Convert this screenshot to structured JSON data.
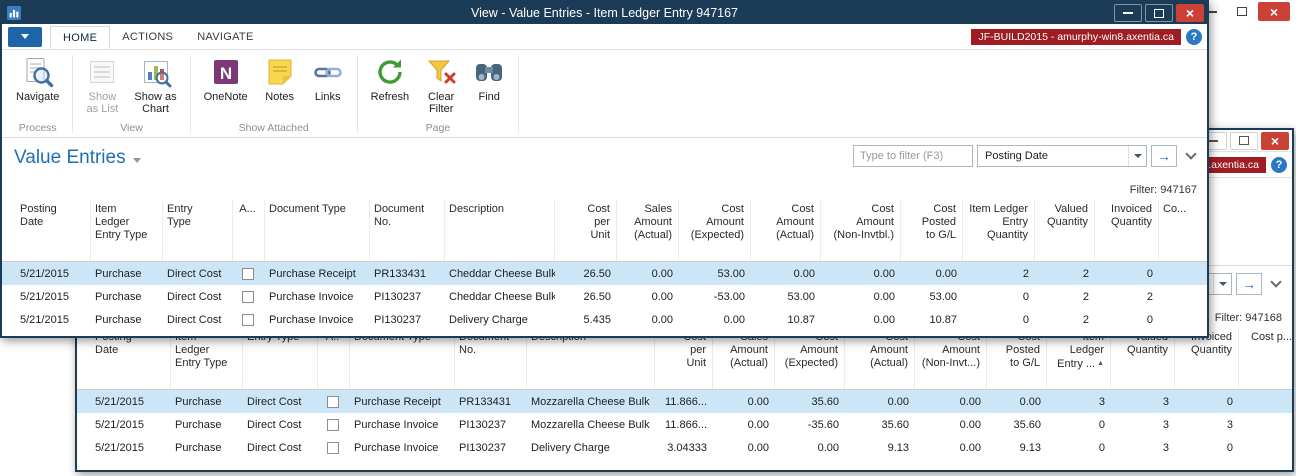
{
  "colors": {
    "titlebar_active": "#1c3b56",
    "window_border": "#1c3b56",
    "close_button_red": "#ca4237",
    "server_badge_red": "#9e1c22",
    "accent_blue": "#1e64a9",
    "help_blue": "#2b79c2",
    "page_title_blue": "#1e6fb8",
    "selected_row_blue": "#cde6f7"
  },
  "windows": [
    {
      "title": "View - Value Entries - Item Ledger Entry 947167",
      "ribbon": {
        "tabs": [
          "HOME",
          "ACTIONS",
          "NAVIGATE"
        ],
        "active_tab": "HOME",
        "server_badge": "JF-BUILD2015 - amurphy-win8.axentia.ca",
        "groups": [
          {
            "label": "Process",
            "buttons": [
              {
                "label": "Navigate",
                "icon": "navigate-icon"
              }
            ]
          },
          {
            "label": "View",
            "buttons": [
              {
                "label": "Show\nas List",
                "icon": "show-as-list-icon",
                "disabled": true
              },
              {
                "label": "Show as\nChart",
                "icon": "show-as-chart-icon"
              }
            ]
          },
          {
            "label": "Show Attached",
            "buttons": [
              {
                "label": "OneNote",
                "icon": "onenote-icon"
              },
              {
                "label": "Notes",
                "icon": "notes-icon"
              },
              {
                "label": "Links",
                "icon": "links-icon"
              }
            ]
          },
          {
            "label": "Page",
            "buttons": [
              {
                "label": "Refresh",
                "icon": "refresh-icon"
              },
              {
                "label": "Clear\nFilter",
                "icon": "clear-filter-icon"
              },
              {
                "label": "Find",
                "icon": "find-icon"
              }
            ]
          }
        ]
      },
      "page": {
        "title": "Value Entries",
        "filter_placeholder": "Type to filter (F3)",
        "filter_column": "Posting Date",
        "filter_label": "Filter: 947167"
      },
      "table": {
        "columns": [
          "Posting\nDate",
          "Item\nLedger\nEntry Type",
          "Entry\nType",
          "A...",
          "Document Type",
          "Document\nNo.",
          "Description",
          "Cost\nper\nUnit",
          "Sales\nAmount\n(Actual)",
          "Cost\nAmount\n(Expected)",
          "Cost\nAmount\n(Actual)",
          "Cost\nAmount\n(Non-Invtbl.)",
          "Cost\nPosted\nto G/L",
          "Item Ledger\nEntry\nQuantity",
          "Valued\nQuantity",
          "Invoiced\nQuantity",
          "Co..."
        ],
        "rows": [
          {
            "selected": true,
            "cells": [
              "5/21/2015",
              "Purchase",
              "Direct Cost",
              false,
              "Purchase Receipt",
              "PR133431",
              "Cheddar Cheese Bulk",
              "26.50",
              "0.00",
              "53.00",
              "0.00",
              "0.00",
              "0.00",
              "2",
              "2",
              "0",
              ""
            ]
          },
          {
            "selected": false,
            "cells": [
              "5/21/2015",
              "Purchase",
              "Direct Cost",
              false,
              "Purchase Invoice",
              "PI130237",
              "Cheddar Cheese Bulk",
              "26.50",
              "0.00",
              "-53.00",
              "53.00",
              "0.00",
              "53.00",
              "0",
              "2",
              "2",
              ""
            ]
          },
          {
            "selected": false,
            "cells": [
              "5/21/2015",
              "Purchase",
              "Direct Cost",
              false,
              "Purchase Invoice",
              "PI130237",
              "Delivery Charge",
              "5.435",
              "0.00",
              "0.00",
              "10.87",
              "0.00",
              "10.87",
              "0",
              "2",
              "0",
              ""
            ]
          }
        ]
      }
    },
    {
      "title": "",
      "ribbon": {
        "tabs": [],
        "active_tab": "",
        "server_badge": "JF-BUILD2015 - amurphy-win8.axentia.ca",
        "groups": []
      },
      "page": {
        "title": "",
        "filter_placeholder": "",
        "filter_column": "",
        "filter_label": "Filter: 947168"
      },
      "table": {
        "sort_column_index": 13,
        "sort_direction": "asc",
        "columns": [
          "Posting\nDate",
          "Item\nLedger\nEntry Type",
          "Entry Type",
          "A..",
          "Document Type",
          "Document\nNo.",
          "Description",
          "Cost\nper\nUnit",
          "Sales\nAmount\n(Actual)",
          "Cost\nAmount\n(Expected)",
          "Cost\nAmount\n(Actual)",
          "Cost\nAmount\n(Non-Invt...)",
          "Cost\nPosted\nto G/L",
          "Item\nLedger\nEntry ...",
          "Valued\nQuantity",
          "Invoiced\nQuantity",
          "Cost p..."
        ],
        "rows": [
          {
            "selected": true,
            "cells": [
              "5/21/2015",
              "Purchase",
              "Direct Cost",
              false,
              "Purchase Receipt",
              "PR133431",
              "Mozzarella Cheese Bulk",
              "11.866...",
              "0.00",
              "35.60",
              "0.00",
              "0.00",
              "0.00",
              "3",
              "3",
              "0",
              ""
            ]
          },
          {
            "selected": false,
            "cells": [
              "5/21/2015",
              "Purchase",
              "Direct Cost",
              false,
              "Purchase Invoice",
              "PI130237",
              "Mozzarella Cheese Bulk",
              "11.866...",
              "0.00",
              "-35.60",
              "35.60",
              "0.00",
              "35.60",
              "0",
              "3",
              "3",
              ""
            ]
          },
          {
            "selected": false,
            "cells": [
              "5/21/2015",
              "Purchase",
              "Direct Cost",
              false,
              "Purchase Invoice",
              "PI130237",
              "Delivery Charge",
              "3.04333",
              "0.00",
              "0.00",
              "9.13",
              "0.00",
              "9.13",
              "0",
              "3",
              "0",
              ""
            ]
          }
        ]
      }
    }
  ]
}
